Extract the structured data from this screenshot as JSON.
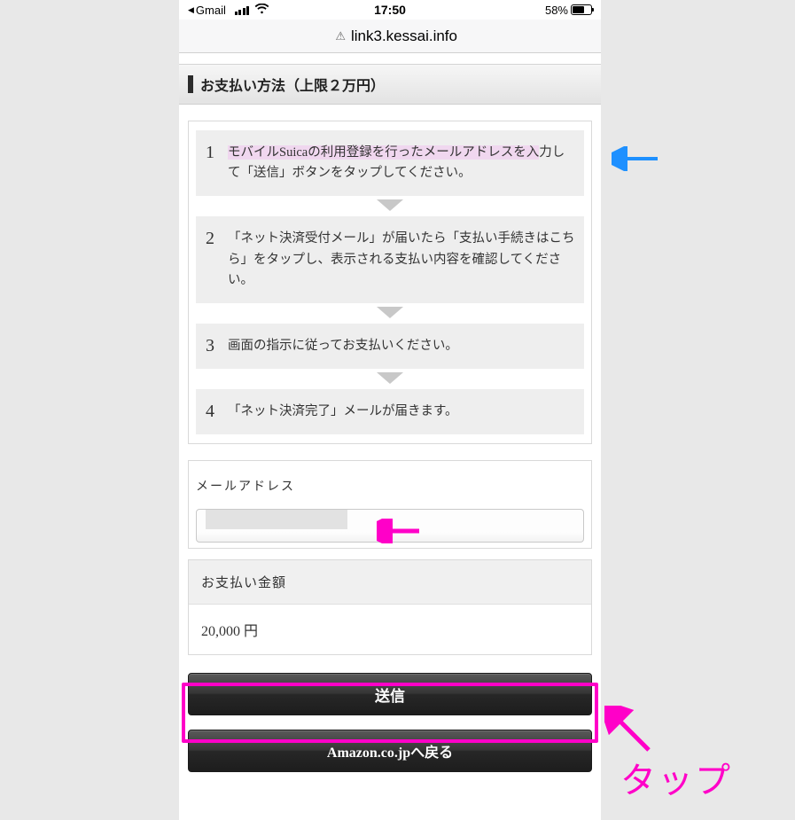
{
  "status": {
    "back_app": "Gmail",
    "time": "17:50",
    "battery_pct": "58%"
  },
  "url_bar": {
    "host": "link3.kessai.info"
  },
  "section_title": "お支払い方法（上限２万円）",
  "steps": {
    "s1": {
      "num": "1",
      "hl": "モバイルSuicaの利用登録を行ったメールアドレスを入",
      "rest": "力して「送信」ボタンをタップしてください。"
    },
    "s2": {
      "num": "2",
      "txt": "「ネット決済受付メール」が届いたら「支払い手続きはこちら」をタップし、表示される支払い内容を確認してください。"
    },
    "s3": {
      "num": "3",
      "txt": "画面の指示に従ってお支払いください。"
    },
    "s4": {
      "num": "4",
      "txt": "「ネット決済完了」メールが届きます。"
    }
  },
  "email": {
    "label": "メールアドレス"
  },
  "amount": {
    "label": "お支払い金額",
    "value": "20,000 円"
  },
  "buttons": {
    "submit": "送信",
    "back": "Amazon.co.jpへ戻る"
  },
  "annotation": {
    "tap": "タップ"
  }
}
